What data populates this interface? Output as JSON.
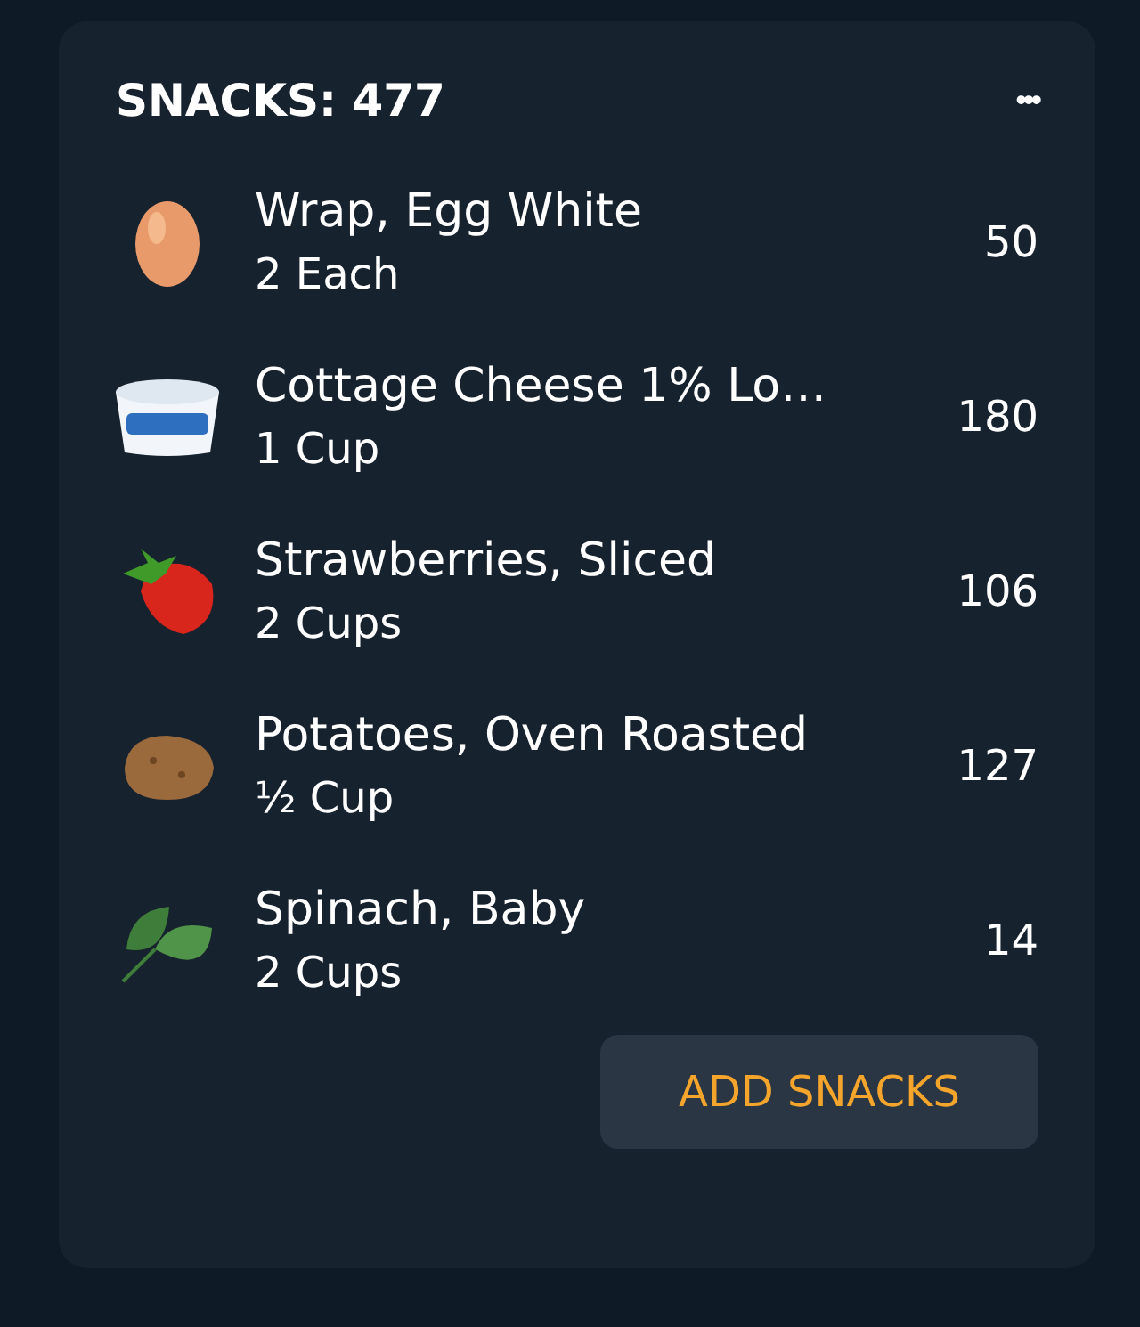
{
  "card": {
    "title": "SNACKS: 477",
    "menu": "•••",
    "items": [
      {
        "kind": "egg",
        "name": "Wrap, Egg White",
        "serving": "2 Each",
        "calories": "50"
      },
      {
        "kind": "tub",
        "name": "Cottage Cheese 1% Lo…",
        "serving": "1 Cup",
        "calories": "180"
      },
      {
        "kind": "strawberry",
        "name": "Strawberries, Sliced",
        "serving": "2 Cups",
        "calories": "106"
      },
      {
        "kind": "potato",
        "name": "Potatoes, Oven Roasted",
        "serving": "½ Cup",
        "calories": "127"
      },
      {
        "kind": "spinach",
        "name": "Spinach, Baby",
        "serving": "2 Cups",
        "calories": "14"
      }
    ],
    "button": "ADD SNACKS"
  }
}
